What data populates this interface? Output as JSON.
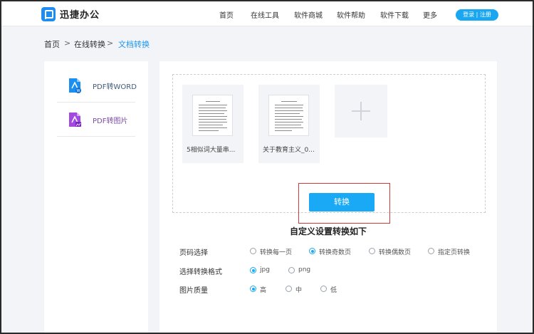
{
  "header": {
    "brand": "迅捷办公",
    "nav": [
      "首页",
      "在线工具",
      "软件商城",
      "软件帮助",
      "软件下载",
      "更多"
    ],
    "login": "登录 | 注册"
  },
  "breadcrumb": [
    "首页",
    "在线转换",
    "文档转换"
  ],
  "breadcrumb_separator": ">",
  "sidebar": {
    "items": [
      {
        "label": "PDF转WORD",
        "icon": "pdf-to-word-icon"
      },
      {
        "label": "PDF转图片",
        "icon": "pdf-to-image-icon"
      }
    ]
  },
  "files": [
    {
      "name": "5相似词大量串..."
    },
    {
      "name": "关于教育主义_0..."
    }
  ],
  "convert_label": "转换",
  "settings": {
    "title": "自定义设置转换如下",
    "page_select": {
      "label": "页码选择",
      "options": [
        "转换每一页",
        "转换奇数页",
        "转换偶数页",
        "指定页转换"
      ],
      "selected": "转换奇数页"
    },
    "format": {
      "label": "选择转换格式",
      "options": [
        "jpg",
        "png"
      ],
      "selected": "jpg"
    },
    "quality": {
      "label": "图片质量",
      "options": [
        "高",
        "中",
        "低"
      ],
      "selected": "高"
    }
  },
  "colors": {
    "accent": "#1aa9f4",
    "highlight_border": "#d23a3a",
    "breadcrumb_active": "#1e96ee"
  }
}
